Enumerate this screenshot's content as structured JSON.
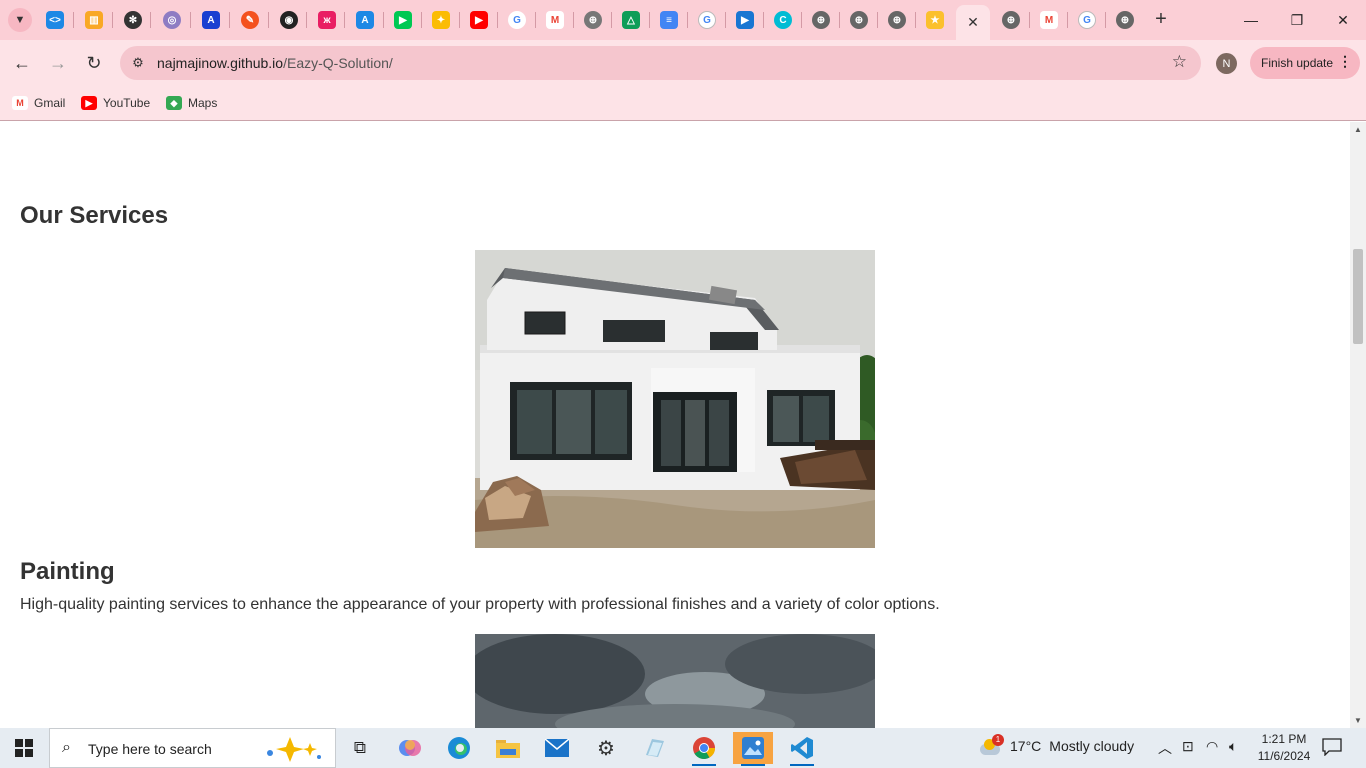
{
  "browser": {
    "url_host": "najmajinow.github.io",
    "url_path": "/Eazy-Q-Solution/",
    "profile_initial": "N",
    "update_label": "Finish update",
    "bookmarks": [
      {
        "label": "Gmail",
        "icon": "gmail-icon",
        "color": "#ea4335"
      },
      {
        "label": "YouTube",
        "icon": "youtube-icon",
        "color": "#ff0000"
      },
      {
        "label": "Maps",
        "icon": "maps-icon",
        "color": "#34a853"
      }
    ]
  },
  "page": {
    "section_title": "Our Services",
    "services": [
      {
        "title": "Painting",
        "description": "High-quality painting services to enhance the appearance of your property with professional finishes and a variety of color options."
      }
    ]
  },
  "taskbar": {
    "search_placeholder": "Type here to search",
    "weather_temp": "17°C",
    "weather_desc": "Mostly cloudy",
    "weather_badge": "1",
    "time": "1:21 PM",
    "date": "11/6/2024"
  },
  "colors": {
    "tab_strip": "#fbcfd6",
    "toolbar": "#fde3e7",
    "heading_text": "#333333"
  }
}
